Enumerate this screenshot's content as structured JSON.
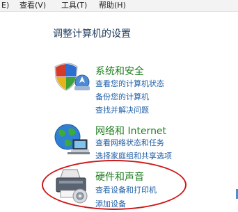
{
  "menu": {
    "items": [
      "E)",
      "查看(V)",
      "工具(T)",
      "帮助(H)"
    ]
  },
  "page": {
    "title": "调整计算机的设置"
  },
  "categories": [
    {
      "title": "系统和安全",
      "icon": "shield-icon",
      "links": [
        "查看您的计算机状态",
        "备份您的计算机",
        "查找并解决问题"
      ]
    },
    {
      "title": "网络和 Internet",
      "icon": "network-globe-icon",
      "links": [
        "查看网络状态和任务",
        "选择家庭组和共享选项"
      ]
    },
    {
      "title": "硬件和声音",
      "icon": "printer-icon",
      "links": [
        "查看设备和打印机",
        "添加设备"
      ]
    }
  ],
  "colors": {
    "category_title": "#1e7d1e",
    "link": "#1f5fa6",
    "highlight": "#d01818"
  }
}
